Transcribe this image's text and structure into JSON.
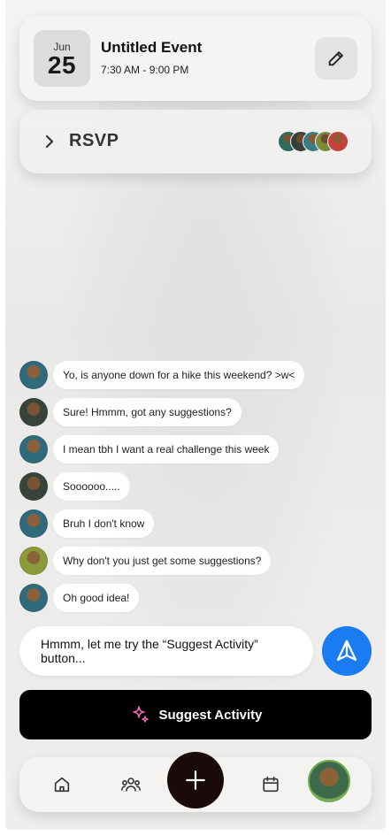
{
  "event": {
    "month": "Jun",
    "day": "25",
    "title": "Untitled Event",
    "time": "7:30 AM - 9:00 PM"
  },
  "rsvp": {
    "label": "RSVP"
  },
  "messages": [
    {
      "text": "Yo, is anyone down for a hike this weekend? >w<",
      "avatar": "person-a"
    },
    {
      "text": "Sure! Hmmm, got any suggestions?",
      "avatar": "person-b"
    },
    {
      "text": "I mean tbh I want a real challenge this week",
      "avatar": "person-a"
    },
    {
      "text": "Soooooo.....",
      "avatar": "person-b"
    },
    {
      "text": "Bruh I don't know",
      "avatar": "person-a"
    },
    {
      "text": "Why don't you just get some suggestions?",
      "avatar": "person-c"
    },
    {
      "text": "Oh good idea!",
      "avatar": "person-a"
    }
  ],
  "composer": {
    "value": "Hmmm, let me try the “Suggest Activity” button..."
  },
  "suggest_button": {
    "label": "Suggest Activity"
  },
  "colors": {
    "accent_blue": "#1a7cf2",
    "fab": "#1b0a0a",
    "suggest_bg": "#000000",
    "sparkle": "#f06ab8"
  },
  "nav": {
    "items": [
      "home-icon",
      "group-icon",
      "plus-icon",
      "calendar-icon",
      "profile-avatar"
    ]
  }
}
